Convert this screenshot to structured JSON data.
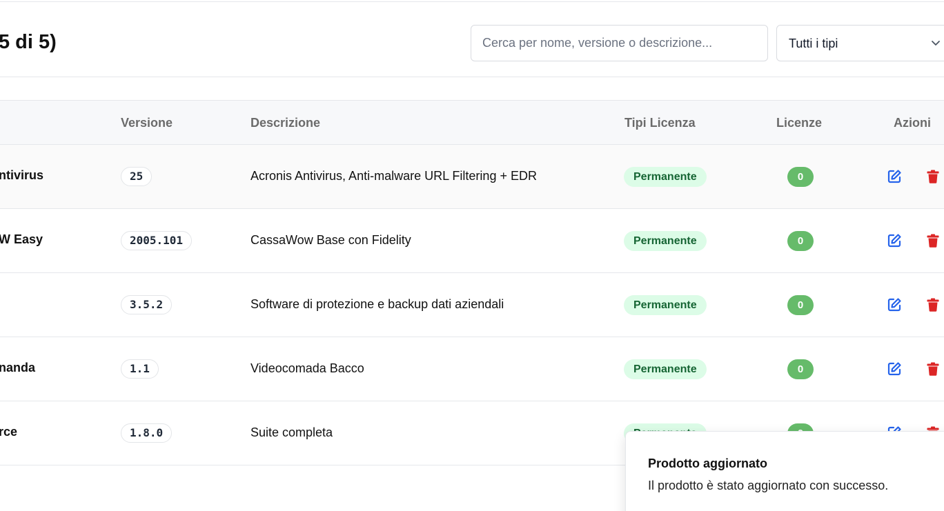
{
  "header": {
    "title_visible": "5 di 5)",
    "search": {
      "placeholder": "Cerca per nome, versione o descrizione...",
      "value": ""
    },
    "type_filter": {
      "selected": "Tutti i tipi",
      "icon": "chevron-down-icon"
    }
  },
  "table": {
    "columns": {
      "version": "Versione",
      "description": "Descrizione",
      "license_types": "Tipi Licenza",
      "licenses": "Licenze",
      "actions": "Azioni"
    },
    "rows": [
      {
        "name_visible": "ntivirus",
        "version": "25",
        "description": "Acronis Antivirus, Anti-malware URL Filtering + EDR",
        "license_type": "Permanente",
        "license_count": "0"
      },
      {
        "name_visible": "W Easy",
        "version": "2005.101",
        "description": "CassaWow Base con Fidelity",
        "license_type": "Permanente",
        "license_count": "0"
      },
      {
        "name_visible": "",
        "version": "3.5.2",
        "description": "Software di protezione e backup dati aziendali",
        "license_type": "Permanente",
        "license_count": "0"
      },
      {
        "name_visible": "nanda",
        "version": "1.1",
        "description": "Videocomada Bacco",
        "license_type": "Permanente",
        "license_count": "0"
      },
      {
        "name_visible": "rce",
        "version": "1.8.0",
        "description": "Suite completa",
        "license_type": "Permanente",
        "license_count": "0"
      }
    ],
    "action_icons": {
      "edit": "edit-icon",
      "delete": "trash-icon"
    }
  },
  "toast": {
    "title": "Prodotto aggiornato",
    "message": "Il prodotto è stato aggiornato con successo."
  },
  "colors": {
    "license_badge_bg": "#dcfce7",
    "license_badge_text": "#166534",
    "count_badge_bg": "#66bb6a",
    "edit_icon": "#2563eb",
    "delete_icon": "#dc2626"
  }
}
